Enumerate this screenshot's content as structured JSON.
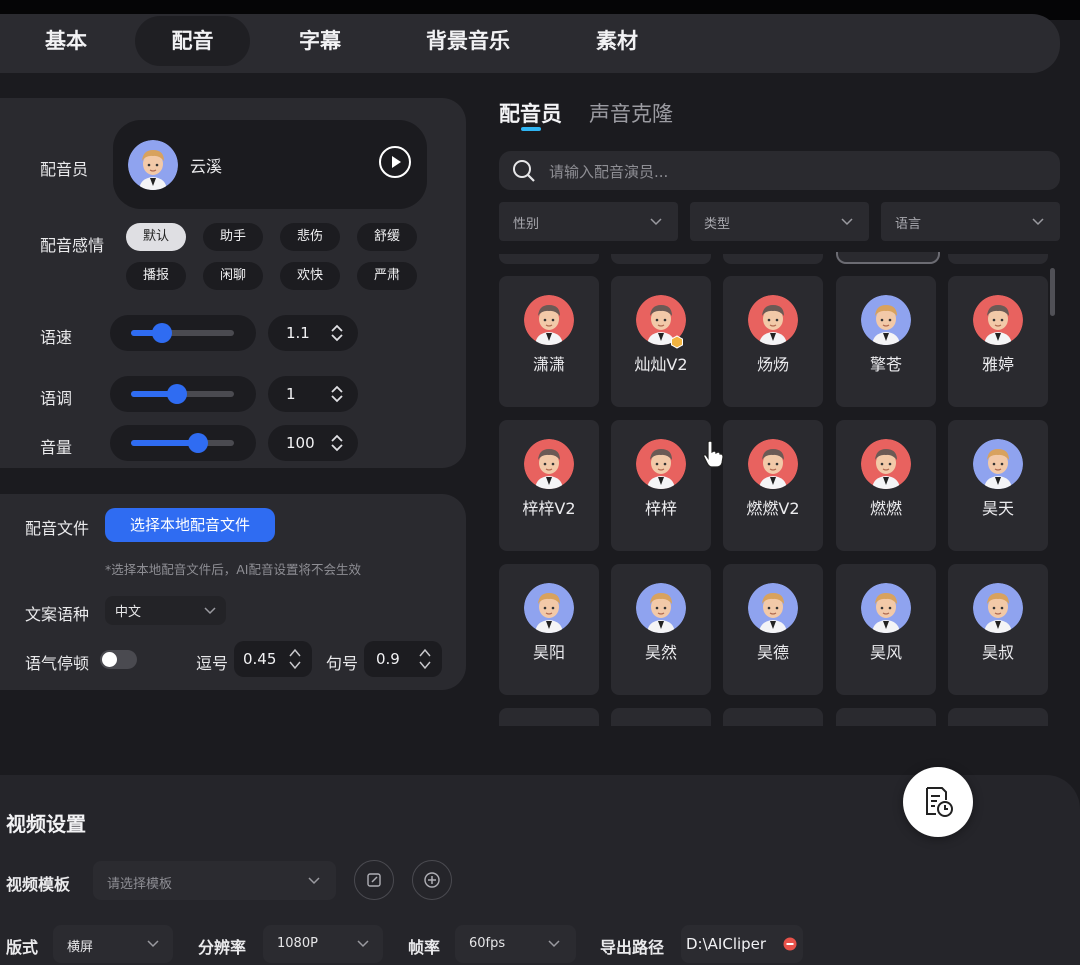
{
  "tabs": [
    "基本",
    "配音",
    "字幕",
    "背景音乐",
    "素材"
  ],
  "voice_panel": {
    "voice_label": "配音员",
    "voice_name": "云溪",
    "emotion_label": "配音感情",
    "emotions": [
      "默认",
      "助手",
      "悲伤",
      "舒缓",
      "播报",
      "闲聊",
      "欢快",
      "严肃"
    ],
    "selected_emotion": "默认",
    "speed_label": "语速",
    "speed_value": "1.1",
    "speed_level": 0.3,
    "pitch_label": "语调",
    "pitch_value": "1",
    "pitch_level": 0.45,
    "volume_label": "音量",
    "volume_value": "100",
    "volume_level": 0.65
  },
  "file_panel": {
    "file_label": "配音文件",
    "file_button": "选择本地配音文件",
    "hint": "*选择本地配音文件后，AI配音设置将不会生效",
    "lang_label": "文案语种",
    "lang_value": "中文",
    "pause_label": "语气停顿",
    "pause_on": false,
    "comma_label": "逗号",
    "comma_value": "0.45",
    "period_label": "句号",
    "period_value": "0.9"
  },
  "right_panel": {
    "tabs": [
      "配音员",
      "声音克隆"
    ],
    "search_placeholder": "请输入配音演员...",
    "filters": [
      "性别",
      "类型",
      "语言"
    ],
    "voices": [
      {
        "name": "潇潇",
        "gender": "female",
        "badge": false
      },
      {
        "name": "灿灿V2",
        "gender": "female",
        "badge": true
      },
      {
        "name": "炀炀",
        "gender": "female",
        "badge": false
      },
      {
        "name": "擎苍",
        "gender": "male",
        "badge": false
      },
      {
        "name": "雅婷",
        "gender": "female",
        "badge": false
      },
      {
        "name": "梓梓V2",
        "gender": "female",
        "badge": false
      },
      {
        "name": "梓梓",
        "gender": "female",
        "badge": false
      },
      {
        "name": "燃燃V2",
        "gender": "female",
        "badge": false
      },
      {
        "name": "燃燃",
        "gender": "female",
        "badge": false
      },
      {
        "name": "昊天",
        "gender": "male",
        "badge": false
      },
      {
        "name": "昊阳",
        "gender": "male",
        "badge": false
      },
      {
        "name": "昊然",
        "gender": "male",
        "badge": false
      },
      {
        "name": "昊德",
        "gender": "male",
        "badge": false
      },
      {
        "name": "昊风",
        "gender": "male",
        "badge": false
      },
      {
        "name": "昊叔",
        "gender": "male",
        "badge": false
      }
    ]
  },
  "video_settings": {
    "title": "视频设置",
    "template_label": "视频模板",
    "template_placeholder": "请选择模板",
    "layout_label": "版式",
    "layout_value": "横屏",
    "resolution_label": "分辨率",
    "resolution_value": "1080P",
    "fps_label": "帧率",
    "fps_value": "60fps",
    "export_label": "导出路径",
    "export_value": "D:\\AICliper"
  },
  "colors": {
    "accent": "#2f6cf2",
    "female_avatar_bg": "#e8625f",
    "male_avatar_bg": "#8fa3ef"
  }
}
